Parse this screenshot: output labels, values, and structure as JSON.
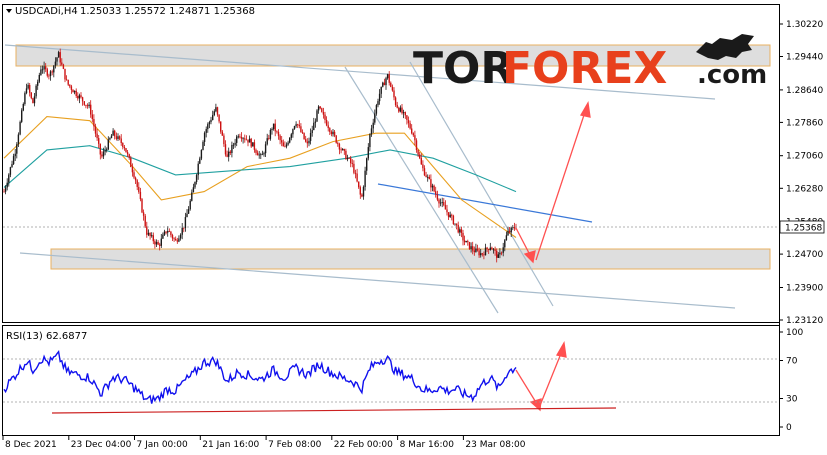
{
  "header": {
    "symbol": "USDCADi,H4",
    "ohlc": "1.25033 1.25572 1.24871 1.25368"
  },
  "logo": {
    "part1": "TOR",
    "part2": "FOREX",
    "part3": ".com"
  },
  "colors": {
    "bull": "#1a1a1a",
    "bear": "#cc1111",
    "ma_fast": "#e8a020",
    "ma_slow": "#20a0a0",
    "rsi": "#1010ee",
    "arrow": "#ff5050",
    "zone": "#d8d8d8",
    "zone_border": "#e8b060",
    "channel": "#a8bccc",
    "trend_blue": "#3a78d8"
  },
  "chart_data": [
    {
      "type": "candlestick",
      "symbol": "USDCADi",
      "timeframe": "H4",
      "last_price": "1.25368",
      "ylim": [
        1.2312,
        1.3022
      ],
      "yticks": [
        "1.30220",
        "1.29440",
        "1.28640",
        "1.27860",
        "1.27060",
        "1.26280",
        "1.25480",
        "1.24700",
        "1.23900",
        "1.23120"
      ],
      "xticks": [
        "8 Dec 2021",
        "23 Dec 04:00",
        "7 Jan 00:00",
        "21 Jan 16:00",
        "7 Feb 08:00",
        "22 Feb 00:00",
        "8 Mar 16:00",
        "23 Mar 08:00"
      ],
      "key_levels": {
        "resistance_zone": [
          1.2935,
          1.2965
        ],
        "support_zone": [
          1.2438,
          1.2485
        ]
      },
      "price_path": [
        [
          0,
          1.262
        ],
        [
          4,
          1.272
        ],
        [
          8,
          1.288
        ],
        [
          10,
          1.283
        ],
        [
          13,
          1.292
        ],
        [
          16,
          1.29
        ],
        [
          19,
          1.295
        ],
        [
          22,
          1.288
        ],
        [
          26,
          1.285
        ],
        [
          30,
          1.282
        ],
        [
          34,
          1.27
        ],
        [
          38,
          1.276
        ],
        [
          42,
          1.273
        ],
        [
          46,
          1.265
        ],
        [
          50,
          1.252
        ],
        [
          54,
          1.249
        ],
        [
          57,
          1.253
        ],
        [
          60,
          1.25
        ],
        [
          63,
          1.254
        ],
        [
          66,
          1.262
        ],
        [
          70,
          1.276
        ],
        [
          74,
          1.282
        ],
        [
          78,
          1.27
        ],
        [
          82,
          1.276
        ],
        [
          86,
          1.274
        ],
        [
          90,
          1.27
        ],
        [
          94,
          1.278
        ],
        [
          98,
          1.272
        ],
        [
          102,
          1.279
        ],
        [
          106,
          1.273
        ],
        [
          110,
          1.282
        ],
        [
          114,
          1.277
        ],
        [
          118,
          1.272
        ],
        [
          122,
          1.268
        ],
        [
          125,
          1.26
        ],
        [
          128,
          1.276
        ],
        [
          131,
          1.285
        ],
        [
          134,
          1.29
        ],
        [
          137,
          1.283
        ],
        [
          140,
          1.28
        ],
        [
          143,
          1.276
        ],
        [
          146,
          1.268
        ],
        [
          149,
          1.264
        ],
        [
          152,
          1.26
        ],
        [
          155,
          1.257
        ],
        [
          158,
          1.254
        ],
        [
          161,
          1.25
        ],
        [
          164,
          1.248
        ],
        [
          167,
          1.247
        ],
        [
          170,
          1.249
        ],
        [
          173,
          1.246
        ],
        [
          176,
          1.252
        ],
        [
          179,
          1.2537
        ]
      ],
      "moving_averages": [
        {
          "color": "#e8a020",
          "path": [
            [
              0,
              1.27
            ],
            [
              15,
              1.28
            ],
            [
              30,
              1.279
            ],
            [
              45,
              1.268
            ],
            [
              55,
              1.26
            ],
            [
              70,
              1.262
            ],
            [
              85,
              1.268
            ],
            [
              100,
              1.27
            ],
            [
              115,
              1.274
            ],
            [
              130,
              1.276
            ],
            [
              140,
              1.276
            ],
            [
              150,
              1.268
            ],
            [
              160,
              1.26
            ],
            [
              179,
              1.251
            ]
          ]
        },
        {
          "color": "#20a0a0",
          "path": [
            [
              0,
              1.263
            ],
            [
              15,
              1.272
            ],
            [
              30,
              1.273
            ],
            [
              45,
              1.27
            ],
            [
              60,
              1.266
            ],
            [
              80,
              1.267
            ],
            [
              100,
              1.268
            ],
            [
              120,
              1.27
            ],
            [
              135,
              1.272
            ],
            [
              150,
              1.27
            ],
            [
              165,
              1.266
            ],
            [
              179,
              1.262
            ]
          ]
        }
      ]
    },
    {
      "type": "line",
      "name": "RSI(13)",
      "label": "RSI(13) 62.6877",
      "value": "62.6877",
      "ylim": [
        0,
        100
      ],
      "yticks": [
        "100",
        "70",
        "30",
        "0"
      ],
      "levels": [
        70,
        30
      ],
      "path": [
        [
          0,
          40
        ],
        [
          4,
          55
        ],
        [
          8,
          70
        ],
        [
          10,
          60
        ],
        [
          13,
          72
        ],
        [
          16,
          68
        ],
        [
          19,
          75
        ],
        [
          22,
          58
        ],
        [
          26,
          55
        ],
        [
          30,
          52
        ],
        [
          34,
          35
        ],
        [
          38,
          52
        ],
        [
          42,
          50
        ],
        [
          46,
          40
        ],
        [
          50,
          28
        ],
        [
          54,
          30
        ],
        [
          57,
          40
        ],
        [
          60,
          38
        ],
        [
          63,
          48
        ],
        [
          66,
          55
        ],
        [
          70,
          68
        ],
        [
          74,
          70
        ],
        [
          78,
          48
        ],
        [
          82,
          58
        ],
        [
          86,
          54
        ],
        [
          90,
          50
        ],
        [
          94,
          60
        ],
        [
          98,
          52
        ],
        [
          102,
          62
        ],
        [
          106,
          55
        ],
        [
          110,
          66
        ],
        [
          114,
          58
        ],
        [
          118,
          52
        ],
        [
          122,
          48
        ],
        [
          125,
          40
        ],
        [
          128,
          62
        ],
        [
          131,
          70
        ],
        [
          134,
          72
        ],
        [
          137,
          58
        ],
        [
          140,
          55
        ],
        [
          143,
          50
        ],
        [
          146,
          40
        ],
        [
          149,
          38
        ],
        [
          152,
          42
        ],
        [
          155,
          38
        ],
        [
          158,
          40
        ],
        [
          161,
          34
        ],
        [
          164,
          32
        ],
        [
          167,
          45
        ],
        [
          170,
          52
        ],
        [
          173,
          40
        ],
        [
          176,
          58
        ],
        [
          179,
          62.69
        ]
      ]
    }
  ]
}
